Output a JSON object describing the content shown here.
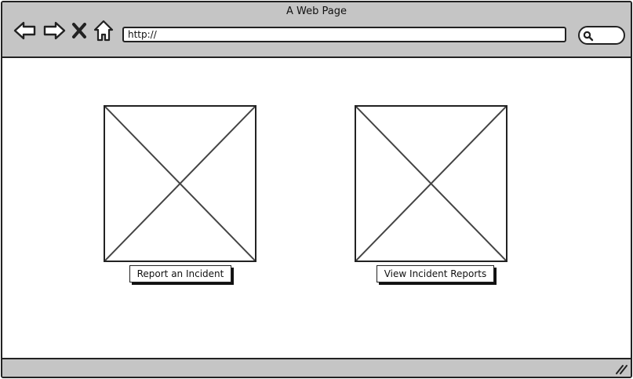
{
  "window": {
    "title": "A Web Page"
  },
  "toolbar": {
    "back_icon": "back-arrow-icon",
    "forward_icon": "forward-arrow-icon",
    "stop_icon": "close-icon",
    "home_icon": "home-icon",
    "address_value": "http://",
    "search_icon": "search-icon"
  },
  "main": {
    "cards": [
      {
        "image": "image-placeholder",
        "button_label": "Report an Incident"
      },
      {
        "image": "image-placeholder",
        "button_label": "View Incident Reports"
      }
    ]
  },
  "statusbar": {
    "grip_icon": "resize-grip-icon"
  },
  "colors": {
    "chrome": "#c5c5c5",
    "ink": "#222222",
    "page": "#ffffff"
  }
}
